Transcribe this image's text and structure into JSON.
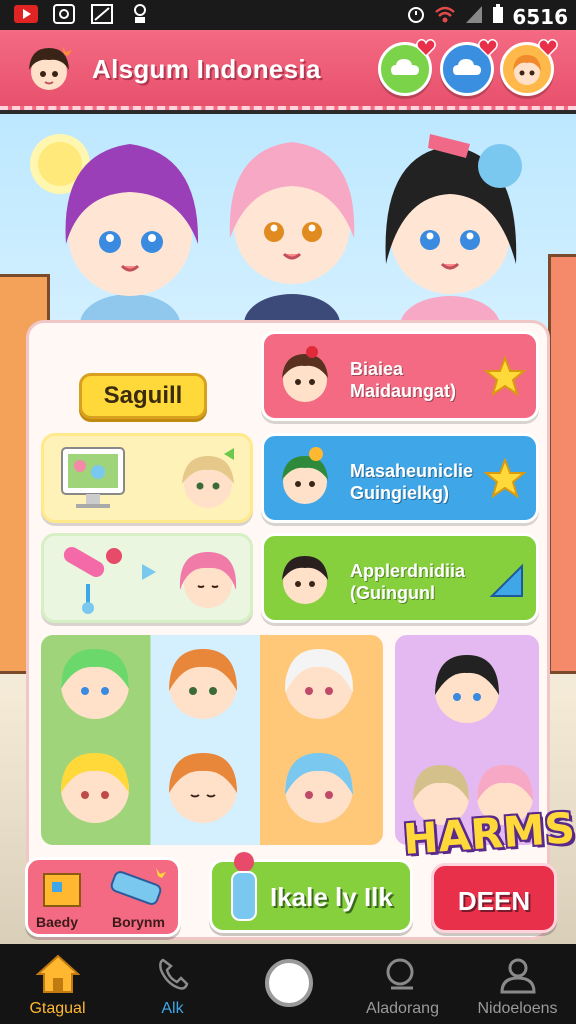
{
  "status_bar": {
    "time": "6516"
  },
  "header": {
    "title": "Alsgum Indonesia"
  },
  "panel": {
    "yellow_button": "Saguill",
    "cards": [
      {
        "line1": "Biaiea",
        "line2": "Maidaungat)"
      },
      {
        "line1": "Masaheuniclie",
        "line2": "Guingielkg)"
      },
      {
        "line1": "Applerdnidiia",
        "line2": "(Guingunl"
      }
    ],
    "bottom": {
      "left_label_1": "Baedy",
      "left_label_2": "Borynm",
      "middle_button": "Ikale ly Ilk",
      "harms_logo": "HARMS",
      "right_button": "DEEN"
    }
  },
  "nav": {
    "items": [
      {
        "label": "Gtagual",
        "icon": "home-icon",
        "active": true
      },
      {
        "label": "Alk",
        "icon": "phone-icon",
        "active": false
      },
      {
        "label": "",
        "icon": "home-circle-icon",
        "active": false
      },
      {
        "label": "Aladorang",
        "icon": "search-icon",
        "active": false
      },
      {
        "label": "Nidoeloens",
        "icon": "profile-icon",
        "active": false
      }
    ]
  },
  "colors": {
    "header": "#e8516d",
    "pink_card": "#f46a82",
    "blue_card": "#3fa6e8",
    "green_card": "#86cf3d",
    "accent_yellow": "#ffd93a"
  }
}
